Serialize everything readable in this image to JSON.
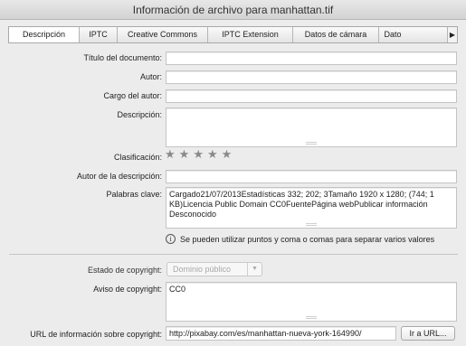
{
  "window": {
    "title": "Información de archivo para manhattan.tif"
  },
  "tabs": [
    {
      "label": "Descripción",
      "active": true
    },
    {
      "label": "IPTC"
    },
    {
      "label": "Creative Commons"
    },
    {
      "label": "IPTC Extension"
    },
    {
      "label": "Datos de cámara"
    },
    {
      "label": "Dato"
    }
  ],
  "tab_scroll_icon": "triangle-right",
  "form": {
    "titulo_label": "Título del documento:",
    "titulo_value": "",
    "autor_label": "Autor:",
    "autor_value": "",
    "cargo_label": "Cargo del autor:",
    "cargo_value": "",
    "descripcion_label": "Descripción:",
    "descripcion_value": "",
    "clasificacion_label": "Clasificación:",
    "rating": {
      "value": 0,
      "max": 5,
      "icon": "star"
    },
    "autor_descripcion_label": "Autor de la descripción:",
    "autor_descripcion_value": "",
    "palabras_label": "Palabras clave:",
    "palabras_value": "Cargado21/07/2013Estadísticas 332; 202; 3Tamaño 1920 x 1280; (744; 1 KB)Licencia Public Domain CC0FuentePágina webPublicar información Desconocido",
    "hint_text": "Se pueden utilizar puntos y coma o comas para separar varios valores",
    "hint_icon": "info-circle",
    "estado_label": "Estado de copyright:",
    "estado_value": "Dominio público",
    "aviso_label": "Aviso de copyright:",
    "aviso_value": "CC0",
    "url_label": "URL de información sobre copyright:",
    "url_value": "http://pixabay.com/es/manhattan-nueva-york-164990/",
    "url_button": "Ir a URL..."
  }
}
